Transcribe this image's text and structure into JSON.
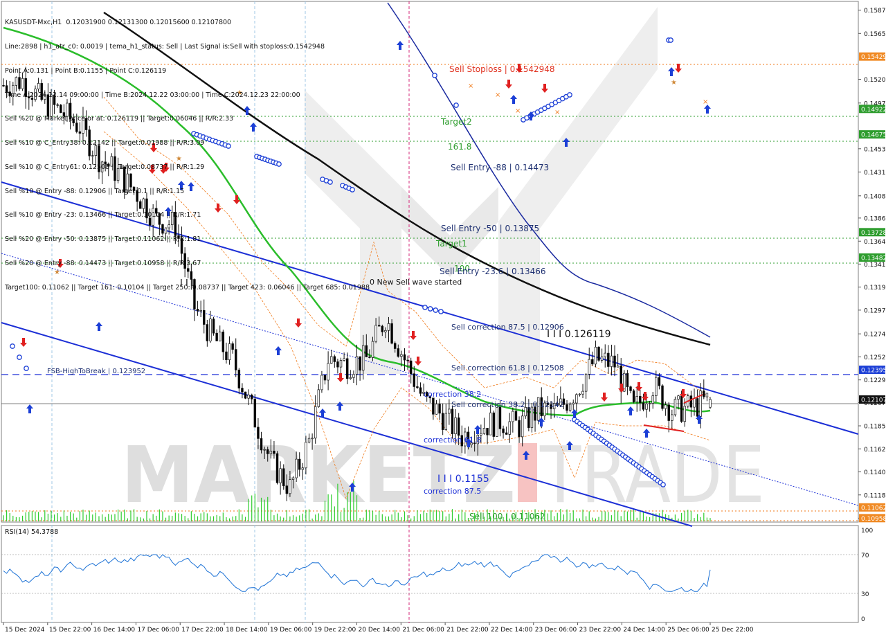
{
  "header": {
    "symbol_line": "KASUSDT-Mxc,H1  0.12031900 0.12131300 0.12015600 0.12107800",
    "info_lines": [
      "Line:2898 | h1_atr_c0: 0.0019 | tema_h1_status: Sell | Last Signal is:Sell with stoploss:0.1542948",
      "Point A:0.131 | Point B:0.1155 | Point C:0.126119",
      "Time A:2024.12.14 09:00:00 | Time B:2024.12.22 03:00:00 | Time C:2024.12.23 22:00:00",
      "Sell %20 @ Market price or at: 0.126119 || Target:0.06046 || R/R:2.33",
      "Sell %10 @ C_Entry38: 0.12142 || Target:0.01988 || R/R:3.09",
      "Sell %10 @ C_Entry61: 0.12508 || Target:0.08737 || R/R:1.29",
      "Sell %10 @ Entry -88: 0.12906 || Target:0.1 || R/R:1.15",
      "Sell %10 @ Entry -23: 0.13466 || Target:0.10104 || R/R:1.71",
      "Sell %20 @ Entry -50: 0.13875 || Target:0.11062 || R/R:1.81",
      "Sell %20 @ Entry -88: 0.14473 || Target:0.10958 || R/R:3.67",
      "Target100: 0.11062 || Target 161: 0.10104 || Target 250: 0.08737 || Target 423: 0.06046 || Target 685: 0.01988"
    ]
  },
  "watermark": {
    "left": "MARKETZ",
    "highlight": "I",
    "right": "TRADE"
  },
  "price_axis": {
    "ticks": [
      "0.15878",
      "0.15653",
      "0.15209",
      "0.14979",
      "0.14536",
      "0.14311",
      "0.14080",
      "0.13865",
      "0.13641",
      "0.13419",
      "0.13196",
      "0.12973",
      "0.12743",
      "0.12520",
      "0.12297",
      "0.12077",
      "0.11852",
      "0.11629",
      "0.11406",
      "0.11183",
      "0.10958"
    ],
    "badges": [
      {
        "value": "0.15429",
        "color": "#f08a24"
      },
      {
        "value": "0.14922",
        "color": "#2e9d2e"
      },
      {
        "value": "0.14675",
        "color": "#2e9d2e"
      },
      {
        "value": "0.13728",
        "color": "#2e9d2e"
      },
      {
        "value": "0.13482",
        "color": "#2e9d2e"
      },
      {
        "value": "0.12395",
        "color": "#1c3fd6"
      },
      {
        "value": "0.12107",
        "color": "#111111"
      },
      {
        "value": "0.11062",
        "color": "#f08a24"
      },
      {
        "value": "0.10958",
        "color": "#f08a24"
      }
    ]
  },
  "time_axis": [
    "15 Dec 2024",
    "15 Dec 22:00",
    "16 Dec 14:00",
    "17 Dec 06:00",
    "17 Dec 22:00",
    "18 Dec 14:00",
    "19 Dec 06:00",
    "19 Dec 22:00",
    "20 Dec 14:00",
    "21 Dec 06:00",
    "21 Dec 22:00",
    "22 Dec 14:00",
    "23 Dec 06:00",
    "23 Dec 22:00",
    "24 Dec 14:00",
    "25 Dec 06:00",
    "25 Dec 22:00"
  ],
  "annotations": {
    "sell_stoploss": "Sell Stoploss | 0.1542948",
    "target2": "Target2",
    "fib_161": "161.8",
    "sell_entry_88": "Sell Entry -88 | 0.14473",
    "sell_entry_50": "Sell Entry -50 | 0.13875",
    "target1": "Target1",
    "fib_100": "100",
    "sell_entry_23": "Sell Entry -23.6 | 0.13466",
    "new_wave": "0 New Sell wave started",
    "correction_875": "Sell correction 87.5 | 0.12906",
    "point_c": "I I I 0.126119",
    "correction_618": "Sell correction 61.8 | 0.12508",
    "fsb": "FSB-HighToBreak | 0.123952",
    "correction_382": "Sell correction 38.2 | 0.12142",
    "corr_382_short": "correction 38.2",
    "corr_618_short": "correction 61.8",
    "point_b": "I I I 0.1155",
    "corr_875_short": "correction 87.5",
    "sell_100": "Sell 100 | 0.11062",
    "point_a": "I I I"
  },
  "rsi": {
    "label": "RSI(14) 54.3788",
    "levels": [
      "100",
      "70",
      "30",
      "0"
    ]
  },
  "colors": {
    "bull_candle": "#ffffff",
    "bear_candle": "#000000",
    "ema_green": "#2bbd2b",
    "ma_black": "#111111",
    "channel_blue": "#1c2fd6",
    "envelope_orange": "#f07a1a",
    "rsi_line": "#1e73d6",
    "volume": "#2fcc2f"
  },
  "chart_data": {
    "type": "candlestick",
    "symbol": "KASUSDT-Mxc",
    "timeframe": "H1",
    "ohlc_last": {
      "open": 0.120319,
      "high": 0.121313,
      "low": 0.120156,
      "close": 0.121078
    },
    "ylim": [
      0.1092,
      0.1595
    ],
    "close_path": [
      [
        0,
        0.1515
      ],
      [
        6,
        0.152
      ],
      [
        12,
        0.15
      ],
      [
        18,
        0.149
      ],
      [
        24,
        0.1475
      ],
      [
        30,
        0.1445
      ],
      [
        36,
        0.143
      ],
      [
        42,
        0.141
      ],
      [
        48,
        0.1385
      ],
      [
        54,
        0.138
      ],
      [
        60,
        0.13
      ],
      [
        66,
        0.127
      ],
      [
        72,
        0.125
      ],
      [
        78,
        0.12
      ],
      [
        84,
        0.115
      ],
      [
        90,
        0.1125
      ],
      [
        96,
        0.117
      ],
      [
        102,
        0.125
      ],
      [
        108,
        0.1245
      ],
      [
        114,
        0.125
      ],
      [
        120,
        0.129
      ],
      [
        126,
        0.125
      ],
      [
        132,
        0.121
      ],
      [
        138,
        0.1195
      ],
      [
        144,
        0.1175
      ],
      [
        150,
        0.1185
      ],
      [
        156,
        0.119
      ],
      [
        162,
        0.1185
      ],
      [
        168,
        0.12
      ],
      [
        174,
        0.12
      ],
      [
        180,
        0.122
      ],
      [
        186,
        0.125
      ],
      [
        192,
        0.1245
      ],
      [
        198,
        0.12
      ],
      [
        204,
        0.1225
      ],
      [
        210,
        0.12
      ],
      [
        216,
        0.1203
      ],
      [
        222,
        0.1211
      ]
    ],
    "x_hours_from": "15 Dec 2024 00:00",
    "point_a": 0.131,
    "point_b": 0.1155,
    "point_c": 0.126119,
    "levels": {
      "stoploss": 0.1542948,
      "target2": 0.14922,
      "fib_161_8": 0.14675,
      "sell_entry_88": 0.14473,
      "sell_entry_50": 0.13875,
      "target1": 0.13728,
      "fib_100": 0.13482,
      "sell_entry_23_6": 0.13466,
      "correction_87_5": 0.12906,
      "correction_61_8": 0.12508,
      "fsb_high_to_break": 0.123952,
      "correction_38_2": 0.12142,
      "sell_100": 0.11062,
      "target_10958": 0.10958
    },
    "rsi_value": 54.3788,
    "rsi_levels": [
      70,
      30
    ]
  }
}
